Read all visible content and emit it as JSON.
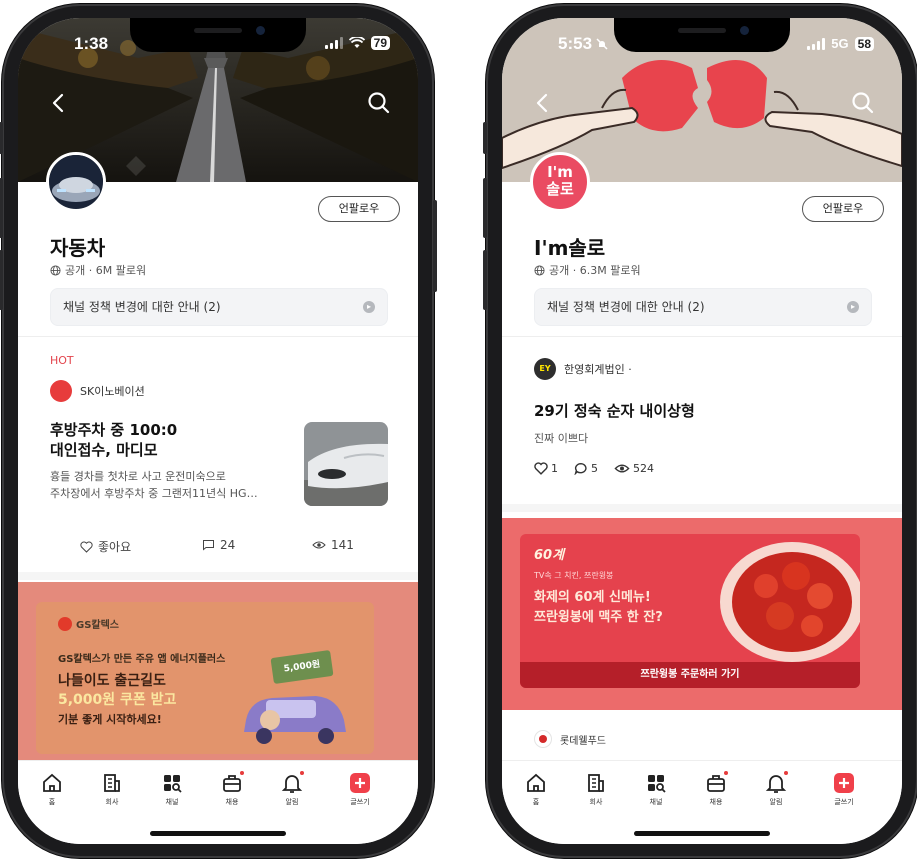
{
  "left_phone": {
    "status_time": "1:38",
    "status_battery": "79",
    "channel_title": "자동차",
    "channel_meta": "공개 · 6M 팔로워",
    "unfollow_label": "언팔로우",
    "notice_label": "채널 정책 변경에 대한 안내 (2)",
    "hot_label": "HOT",
    "post": {
      "author": "SK이노베이션",
      "title_line1": "후방주차 중 100:0 ",
      "title_line2": "대인접수, 마디모",
      "body_line1": "흉들 경차를 첫차로 사고 운전미숙으로",
      "body_line2": "주차장에서 후방주차 중 그랜저11년식 HG…",
      "likes_label": "좋아요",
      "comments": "24",
      "views": "141"
    },
    "ad": {
      "brand": "GS칼텍스",
      "headline": "GS칼텍스가 만든 주유 앱 에너지플러스",
      "line1": "나들이도 출근길도",
      "line2": "5,000원 쿠폰 받고",
      "line3": "기분 좋게 시작하세요!",
      "coupon": "5,000원"
    }
  },
  "right_phone": {
    "status_time": "5:53",
    "status_network": "5G",
    "status_battery": "58",
    "channel_title": "I'm솔로",
    "avatar_text_1": "I'm",
    "avatar_text_2": "솔로",
    "channel_meta": "공개 · 6.3M 팔로워",
    "unfollow_label": "언팔로우",
    "notice_label": "채널 정책 변경에 대한 안내 (2)",
    "post": {
      "author": "한영회계법인 ·",
      "author_logo": "EY",
      "title": "29기 정숙 순자 내이상형",
      "body": "진짜 이쁘다",
      "likes": "1",
      "comments": "5",
      "views": "524"
    },
    "ad": {
      "brand": "60계",
      "tagline": "TV속 그 치킨, 쯔란윙봉",
      "headline1": "화제의 60계 신메뉴!",
      "headline2": "쯔란윙봉에 맥주 한 잔?",
      "cta": "쯔란윙봉 주문하러 가기"
    },
    "next_author": "롯데웰푸드"
  },
  "tabbar": {
    "home": "홈",
    "company": "회사",
    "channel": "채널",
    "jobs": "채용",
    "alerts": "알림",
    "write": "글쓰기"
  },
  "colors": {
    "hot": "#e3454d",
    "brand_red": "#f0404a",
    "left_ad_bg": "#e48a7c",
    "right_ad_bg": "#ec6b6b"
  }
}
